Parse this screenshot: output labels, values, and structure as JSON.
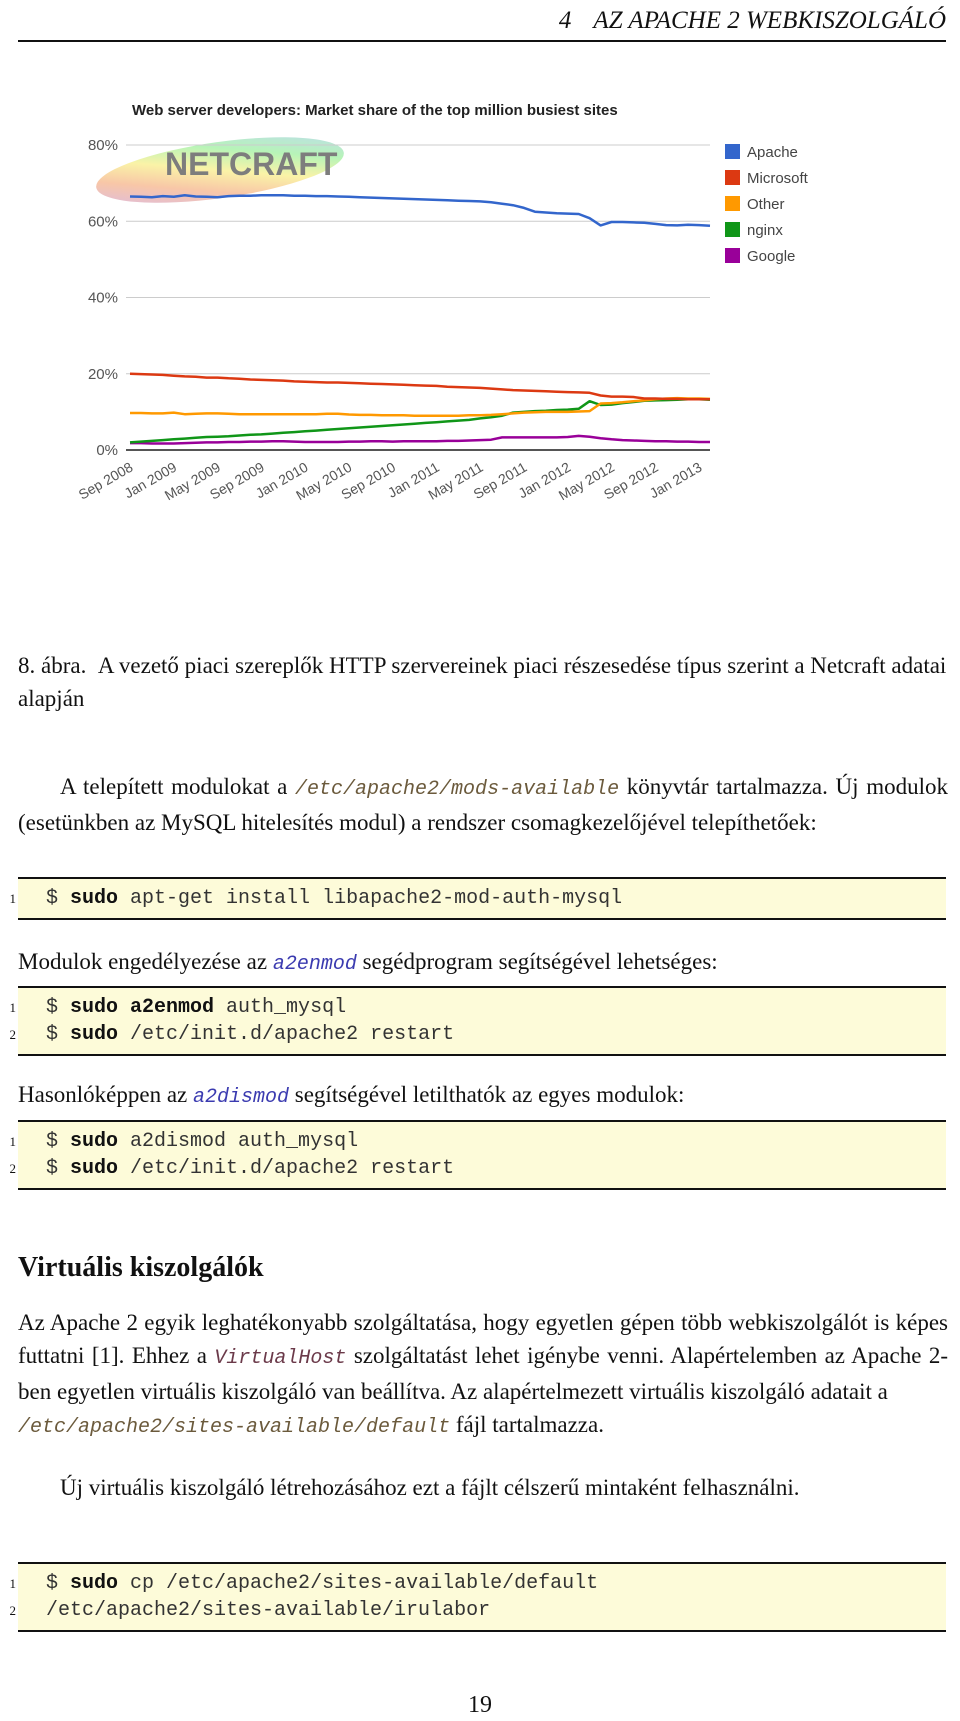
{
  "header": {
    "chapter_number": "4",
    "chapter_title": "AZ APACHE 2 WEBKISZOLGÁLÓ"
  },
  "figure": {
    "logo_text": "NETCRAFT",
    "chart_data": {
      "type": "line",
      "title": "Web server developers: Market share of the top million busiest sites",
      "xlabel": "",
      "ylabel": "",
      "ylim": [
        0,
        80
      ],
      "yticks": [
        "0%",
        "20%",
        "40%",
        "60%",
        "80%"
      ],
      "ytick_values": [
        0,
        20,
        40,
        60,
        80
      ],
      "grid": true,
      "legend_position": "right",
      "x_tick_labels": [
        "Sep 2008",
        "Jan 2009",
        "May 2009",
        "Sep 2009",
        "Jan 2010",
        "May 2010",
        "Sep 2010",
        "Jan 2011",
        "May 2011",
        "Sep 2011",
        "Jan 2012",
        "May 2012",
        "Sep 2012",
        "Jan 2013"
      ],
      "x": [
        0,
        1,
        2,
        3,
        4,
        5,
        6,
        7,
        8,
        9,
        10,
        11,
        12,
        13,
        14,
        15,
        16,
        17,
        18,
        19,
        20,
        21,
        22,
        23,
        24,
        25,
        26,
        27,
        28,
        29,
        30,
        31,
        32,
        33,
        34,
        35,
        36,
        37,
        38,
        39,
        40,
        41,
        42,
        43,
        44,
        45,
        46,
        47,
        48,
        49,
        50,
        51,
        52,
        53
      ],
      "x_note": "months since Sep 2008",
      "series": [
        {
          "name": "Apache",
          "color": "#3366cc",
          "values": [
            66.5,
            66.4,
            66.3,
            66.6,
            66.4,
            66.8,
            66.5,
            66.4,
            66.3,
            66.6,
            66.7,
            66.7,
            66.8,
            66.8,
            66.8,
            66.7,
            66.7,
            66.6,
            66.6,
            66.5,
            66.4,
            66.3,
            66.2,
            66.1,
            66.0,
            65.9,
            65.8,
            65.7,
            65.6,
            65.5,
            65.4,
            65.3,
            65.2,
            65.0,
            64.6,
            64.2,
            63.5,
            62.5,
            62.3,
            62.1,
            62.0,
            61.9,
            60.8,
            58.9,
            59.8,
            59.8,
            59.7,
            59.6,
            59.3,
            59.0,
            58.9,
            59.1,
            59.0,
            58.8
          ]
        },
        {
          "name": "Microsoft",
          "color": "#dc3912",
          "values": [
            20.0,
            19.9,
            19.8,
            19.7,
            19.5,
            19.3,
            19.2,
            19.0,
            19.0,
            18.8,
            18.7,
            18.5,
            18.4,
            18.3,
            18.2,
            18.0,
            17.9,
            17.8,
            17.7,
            17.7,
            17.6,
            17.5,
            17.4,
            17.3,
            17.2,
            17.1,
            17.0,
            16.9,
            16.8,
            16.6,
            16.5,
            16.4,
            16.3,
            16.1,
            15.9,
            15.7,
            15.6,
            15.5,
            15.4,
            15.3,
            15.2,
            15.1,
            15.0,
            14.3,
            14.0,
            14.0,
            13.9,
            13.5,
            13.5,
            13.4,
            13.4,
            13.3,
            13.3,
            13.3
          ]
        },
        {
          "name": "Other",
          "color": "#ff9900",
          "values": [
            9.7,
            9.7,
            9.6,
            9.6,
            9.8,
            9.4,
            9.5,
            9.6,
            9.6,
            9.5,
            9.4,
            9.4,
            9.4,
            9.4,
            9.4,
            9.4,
            9.4,
            9.4,
            9.5,
            9.5,
            9.3,
            9.2,
            9.2,
            9.1,
            9.1,
            9.1,
            9.0,
            9.0,
            9.0,
            9.0,
            9.0,
            9.1,
            9.1,
            9.2,
            9.4,
            9.6,
            9.8,
            9.9,
            10.0,
            10.0,
            10.0,
            10.1,
            10.2,
            12.2,
            12.3,
            12.5,
            12.8,
            13.0,
            13.3,
            13.5,
            13.6,
            13.5,
            13.5,
            13.4
          ]
        },
        {
          "name": "nginx",
          "color": "#109618",
          "values": [
            2.0,
            2.2,
            2.4,
            2.6,
            2.8,
            3.0,
            3.2,
            3.4,
            3.5,
            3.6,
            3.8,
            4.0,
            4.1,
            4.3,
            4.5,
            4.7,
            4.9,
            5.1,
            5.3,
            5.5,
            5.7,
            5.9,
            6.1,
            6.3,
            6.5,
            6.7,
            6.9,
            7.1,
            7.3,
            7.5,
            7.7,
            7.9,
            8.3,
            8.6,
            9.0,
            9.8,
            10.0,
            10.2,
            10.3,
            10.5,
            10.6,
            10.8,
            12.8,
            11.8,
            11.9,
            12.3,
            12.6,
            12.9,
            13.0,
            13.1,
            13.2,
            13.3,
            13.3,
            13.2
          ]
        },
        {
          "name": "Google",
          "color": "#990099",
          "values": [
            1.8,
            1.8,
            1.7,
            1.7,
            1.7,
            1.8,
            1.9,
            2.0,
            2.0,
            2.1,
            2.1,
            2.2,
            2.2,
            2.3,
            2.3,
            2.2,
            2.1,
            2.1,
            2.1,
            2.1,
            2.2,
            2.2,
            2.3,
            2.3,
            2.2,
            2.3,
            2.3,
            2.3,
            2.3,
            2.4,
            2.4,
            2.5,
            2.6,
            2.7,
            3.3,
            3.3,
            3.3,
            3.3,
            3.3,
            3.3,
            3.4,
            3.7,
            3.5,
            3.1,
            2.8,
            2.6,
            2.5,
            2.4,
            2.3,
            2.3,
            2.2,
            2.2,
            2.1,
            2.1
          ]
        }
      ]
    }
  },
  "caption": {
    "label": "8. ábra.",
    "text": "A vezető piaci szereplők HTTP szervereinek piaci részesedése típus szerint a Netcraft adatai alapján"
  },
  "para1": {
    "before": "A telepített modulokat a ",
    "code": "/etc/apache2/mods-available",
    "after": " könyvtár tartalmazza. Új modulok (esetünkben az MySQL hitelesítés modul) a rendszer csomagkezelőjével telepíthetőek:"
  },
  "code1": [
    {
      "num": "1",
      "prompt": "$ ",
      "bold": "sudo",
      "rest": " apt-get install libapache2-mod-auth-mysql"
    }
  ],
  "para2": {
    "before": "Modulok engedélyezése az ",
    "code": "a2enmod",
    "after": " segédprogram segítségével lehetséges:"
  },
  "code2": [
    {
      "num": "1",
      "prompt": "$ ",
      "bold": "sudo a2enmod",
      "rest": " auth_mysql"
    },
    {
      "num": "2",
      "prompt": "$ ",
      "bold": "sudo",
      "rest": " /etc/init.d/apache2 restart"
    }
  ],
  "para3": {
    "before": "Hasonlóképpen az ",
    "code": "a2dismod",
    "after": " segítségével letilthatók az egyes modulok:"
  },
  "code3": [
    {
      "num": "1",
      "prompt": "$ ",
      "bold": "sudo",
      "rest": " a2dismod auth_mysql"
    },
    {
      "num": "2",
      "prompt": "$ ",
      "bold": "sudo",
      "rest": " /etc/init.d/apache2 restart"
    }
  ],
  "section": {
    "title": "Virtuális kiszolgálók"
  },
  "para4": {
    "before": "Az Apache 2 egyik leghatékonyabb szolgáltatása, hogy egyetlen gépen több webkiszolgálót is képes futtatni [1]. Ehhez a ",
    "code": "VirtualHost",
    "after": " szolgáltatást lehet igénybe venni. Alapértelemben az Apache 2-ben egyetlen virtuális kiszolgáló van beállítva. Az alapértelmezett virtuális kiszolgáló adatait a "
  },
  "para4b": {
    "code": "/etc/apache2/sites-available/default",
    "after": " fájl tartalmazza."
  },
  "para5": {
    "text": "Új virtuális kiszolgáló létrehozásához ezt a fájlt célszerű mintaként felhasználni."
  },
  "code4": [
    {
      "num": "1",
      "prompt": "$ ",
      "bold": "sudo",
      "rest": " cp /etc/apache2/sites-available/default"
    },
    {
      "num": "2",
      "prompt": "",
      "bold": "",
      "rest": "/etc/apache2/sites-available/irulabor"
    }
  ],
  "footer": {
    "page_number": "19"
  }
}
